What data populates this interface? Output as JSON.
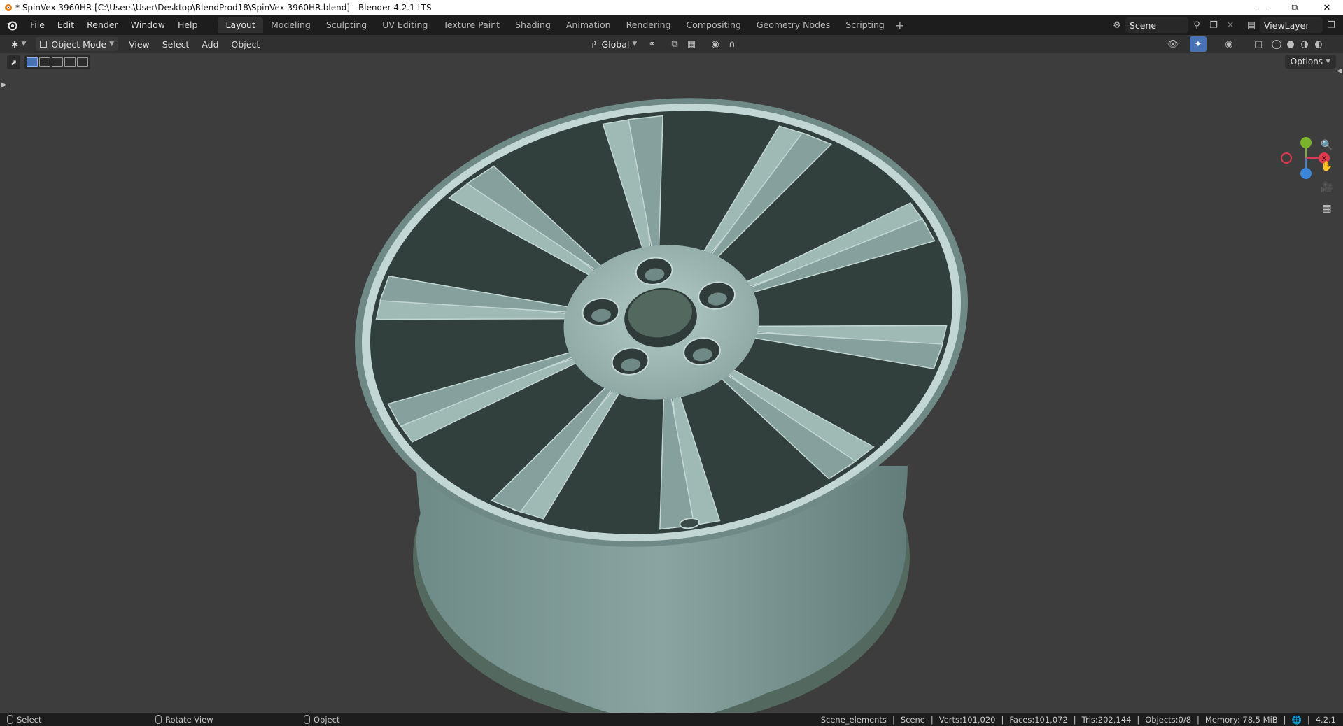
{
  "window": {
    "title": "* SpinVex 3960HR [C:\\Users\\User\\Desktop\\BlendProd18\\SpinVex 3960HR.blend] - Blender 4.2.1 LTS",
    "controls": [
      "minimize",
      "restore",
      "close"
    ]
  },
  "menu": [
    "File",
    "Edit",
    "Render",
    "Window",
    "Help"
  ],
  "workspaces": [
    {
      "label": "Layout",
      "active": true
    },
    {
      "label": "Modeling",
      "active": false
    },
    {
      "label": "Sculpting",
      "active": false
    },
    {
      "label": "UV Editing",
      "active": false
    },
    {
      "label": "Texture Paint",
      "active": false
    },
    {
      "label": "Shading",
      "active": false
    },
    {
      "label": "Animation",
      "active": false
    },
    {
      "label": "Rendering",
      "active": false
    },
    {
      "label": "Compositing",
      "active": false
    },
    {
      "label": "Geometry Nodes",
      "active": false
    },
    {
      "label": "Scripting",
      "active": false
    }
  ],
  "scene": {
    "name": "Scene"
  },
  "view_layer": {
    "name": "ViewLayer"
  },
  "viewport_header": {
    "mode": "Object Mode",
    "menus": [
      "View",
      "Select",
      "Add",
      "Object"
    ],
    "transform_orientation": "Global",
    "options_label": "Options"
  },
  "gizmo": {
    "x_label": "X",
    "y_label": "Y",
    "z_label": "Z"
  },
  "status": {
    "hints": [
      "Select",
      "Rotate View",
      "Object"
    ],
    "collection": "Scene_elements",
    "scene": "Scene",
    "verts": "Verts:101,020",
    "faces": "Faces:101,072",
    "tris": "Tris:202,144",
    "objects": "Objects:0/8",
    "memory": "Memory: 78.5 MiB",
    "version": "4.2.1"
  },
  "colors": {
    "viewport_bg": "#3d3d3d",
    "wheel_base": "#8aa7a3",
    "wheel_light": "#a9c3bf",
    "wheel_dark": "#5f7a77",
    "accent_blue": "#4772b3",
    "gizmo_x": "#e0384d",
    "gizmo_y": "#7cb32d",
    "gizmo_z": "#3b86d9"
  }
}
